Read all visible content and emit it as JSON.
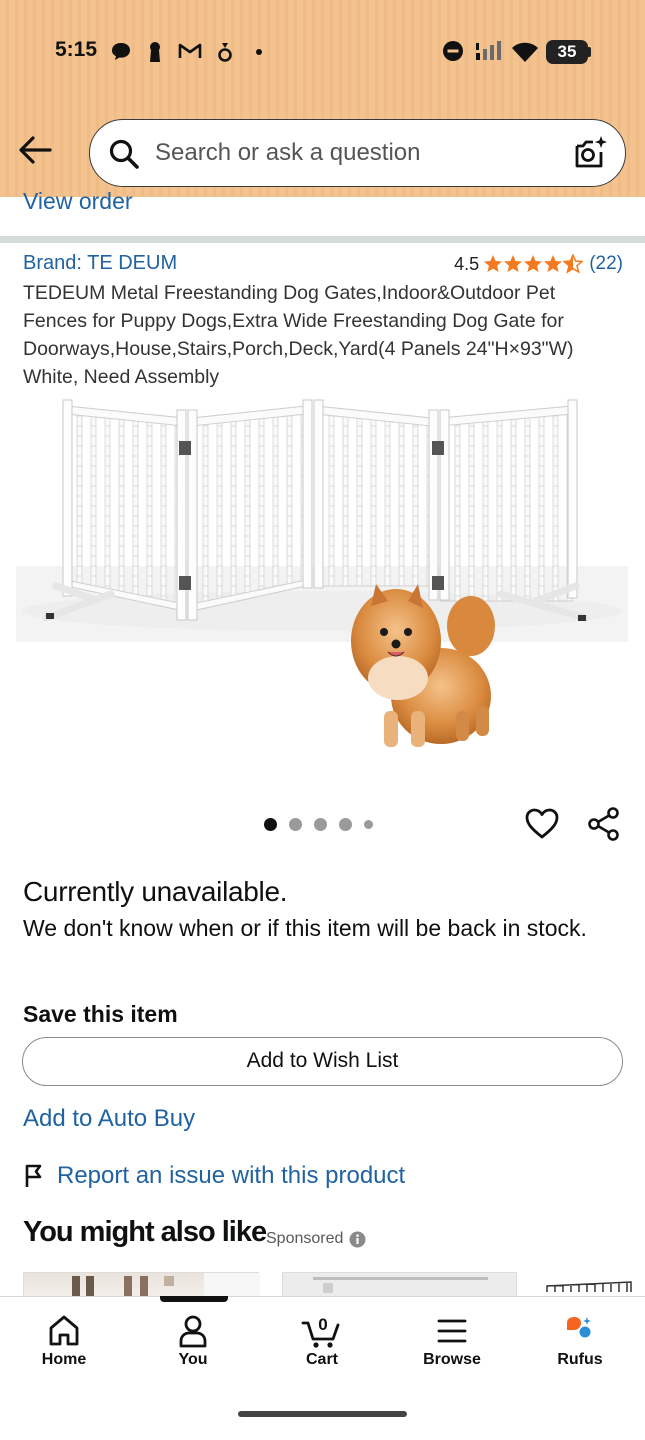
{
  "status_bar": {
    "time": "5:15",
    "battery": "35"
  },
  "search": {
    "placeholder": "Search or ask a question"
  },
  "top_link": {
    "view_order": "View order"
  },
  "product": {
    "brand": "Brand: TE DEUM",
    "rating_value": "4.5",
    "rating_stars": 4.5,
    "rating_count": "(22)",
    "title": "TEDEUM Metal Freestanding Dog Gates,Indoor&Outdoor Pet Fences for Puppy Dogs,Extra Wide Freestanding Dog Gate for Doorways,House,Stairs,Porch,Deck,Yard(4 Panels 24\"H×93\"W) White, Need Assembly",
    "image_count": 5,
    "active_image_index": 0
  },
  "availability": {
    "heading": "Currently unavailable.",
    "message": "We don't know when or if this item will be back in stock."
  },
  "save_item": {
    "heading": "Save this item",
    "wishlist_button": "Add to Wish List",
    "auto_buy": "Add to Auto Buy",
    "report": "Report an issue with this product"
  },
  "recommendations": {
    "heading": "You might also like",
    "sponsored": "Sponsored"
  },
  "bottom_nav": {
    "items": [
      {
        "label": "Home",
        "icon": "home-icon"
      },
      {
        "label": "You",
        "icon": "person-icon"
      },
      {
        "label": "Cart",
        "icon": "cart-icon",
        "count": "0"
      },
      {
        "label": "Browse",
        "icon": "menu-icon"
      },
      {
        "label": "Rufus",
        "icon": "rufus-icon"
      }
    ]
  },
  "colors": {
    "header_bg": "#f3c28e",
    "link": "#2162a1",
    "star": "#f47a1f",
    "text": "#0f1111"
  }
}
